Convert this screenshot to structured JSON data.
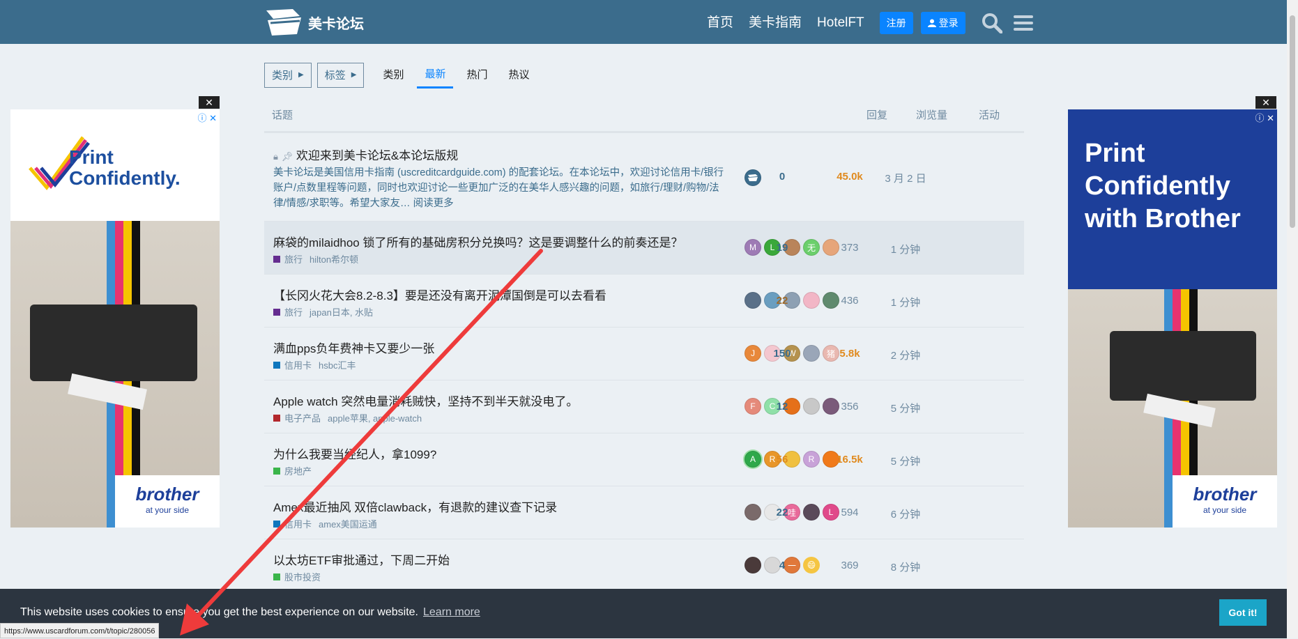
{
  "header": {
    "site_title": "美卡论坛",
    "nav": [
      "首页",
      "美卡指南",
      "HotelFT"
    ],
    "register_label": "注册",
    "login_label": "登录",
    "bg_color": "#3b6c8c"
  },
  "filters": {
    "category_dropdown": "类别",
    "tag_dropdown": "标签",
    "tabs": [
      "类别",
      "最新",
      "热门",
      "热议"
    ],
    "active_tab": "最新"
  },
  "table_header": {
    "topic": "话题",
    "replies": "回复",
    "views": "浏览量",
    "activity": "活动"
  },
  "topics": [
    {
      "title": "欢迎来到美卡论坛&本论坛版规",
      "excerpt": "美卡论坛是美国信用卡指南 (uscreditcardguide.com) 的配套论坛。在本论坛中，欢迎讨论信用卡/银行账户/点数里程等问题，同时也欢迎讨论一些更加广泛的在美华人感兴趣的问题，如旅行/理财/购物/法律/情感/求职等。希望大家友… 阅读更多",
      "replies": "0",
      "views": "45.0k",
      "activity": "3 月 2 日",
      "avatars": [
        "logo"
      ],
      "pinned": true
    },
    {
      "title": "麻袋的milaidhoo 锁了所有的基础房积分兑换吗？这是要调整什么的前奏还是？",
      "category": "旅行",
      "category_color": "#652d90",
      "tags": "hilton希尔顿",
      "replies": "19",
      "views": "373",
      "activity": "1 分钟",
      "avatars": [
        "M",
        "L",
        "",
        "无",
        ""
      ]
    },
    {
      "title": "【长冈火花大会8.2-8.3】要是还没有离开泥潭国倒是可以去看看",
      "category": "旅行",
      "category_color": "#652d90",
      "tags": "japan日本, 水贴",
      "replies": "22",
      "views": "436",
      "activity": "1 分钟",
      "avatars": [
        "",
        "",
        "",
        "",
        ""
      ]
    },
    {
      "title": "满血pps负年费神卡又要少一张",
      "category": "信用卡",
      "category_color": "#0e76bd",
      "tags": "hsbc汇丰",
      "replies": "150",
      "views": "5.8k",
      "activity": "2 分钟",
      "avatars": [
        "J",
        "",
        "W",
        "",
        "猪"
      ]
    },
    {
      "title": "Apple watch 突然电量消耗贼快，坚持不到半天就没电了。",
      "category": "电子产品",
      "category_color": "#b3282d",
      "tags": "apple苹果, apple-watch",
      "replies": "12",
      "views": "356",
      "activity": "5 分钟",
      "avatars": [
        "F",
        "C",
        "",
        "",
        ""
      ]
    },
    {
      "title": "为什么我要当经纪人，拿1099?",
      "category": "房地产",
      "category_color": "#3ab54a",
      "tags": "",
      "replies": "56",
      "views": "16.5k",
      "activity": "5 分钟",
      "avatars": [
        "A",
        "R",
        "",
        "R",
        ""
      ]
    },
    {
      "title": "Amex最近抽风 双倍clawback，有退款的建议查下记录",
      "category": "信用卡",
      "category_color": "#0e76bd",
      "tags": "amex美国运通",
      "replies": "22",
      "views": "594",
      "activity": "6 分钟",
      "avatars": [
        "",
        "",
        "哇",
        "",
        "L"
      ]
    },
    {
      "title": "以太坊ETF审批通过，下周二开始",
      "category": "股市投资",
      "category_color": "#3ab54a",
      "tags": "",
      "replies": "4",
      "views": "369",
      "activity": "8 分钟",
      "avatars": [
        "",
        "",
        "一",
        "😄"
      ]
    }
  ],
  "ads": {
    "left_title": "Print Confidently.",
    "right_title": "Print Confidently with Brother",
    "brand": "brother",
    "brand_sub": "at your side",
    "close": "✕"
  },
  "cookie": {
    "message": "This website uses cookies to ensure you get the best experience on our website.",
    "learn_more": "Learn more",
    "button": "Got it!"
  },
  "status_url": "https://www.uscardforum.com/t/topic/280056"
}
